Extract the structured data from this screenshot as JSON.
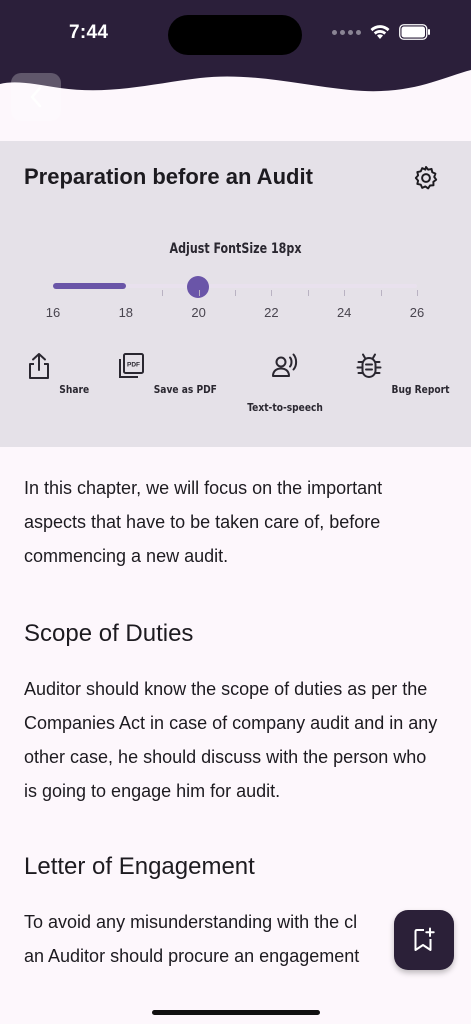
{
  "status_bar": {
    "time": "7:44"
  },
  "panel": {
    "title": "Preparation before an Audit",
    "font_size_label": "Adjust FontSize 18px",
    "slider": {
      "min": 16,
      "max": 26,
      "value": 18,
      "labels": [
        "16",
        "18",
        "20",
        "22",
        "24",
        "26"
      ]
    },
    "actions": [
      {
        "label": "Share",
        "icon": "share-icon"
      },
      {
        "label": "Save as PDF",
        "icon": "pdf-icon"
      },
      {
        "label": "Text-to-speech",
        "icon": "speech-icon"
      },
      {
        "label": "Bug Report",
        "icon": "bug-icon"
      }
    ]
  },
  "content": {
    "intro": "In this chapter, we will focus on the important aspects that have to be taken care of, before commencing a new audit.",
    "section1_title": "Scope of Duties",
    "section1_body": "Auditor should know the scope of duties as per the Companies Act in case of company audit and in any other case, he should discuss with the person who is going to engage him for audit.",
    "section2_title": "Letter of Engagement",
    "section2_line1": "To avoid any misunderstanding with the cl",
    "section2_line2": "an Auditor should procure an engagement"
  },
  "colors": {
    "header": "#2b1f3a",
    "accent": "#6a55a8",
    "panel": "#e5e1e8",
    "background": "#fdf7fc"
  }
}
